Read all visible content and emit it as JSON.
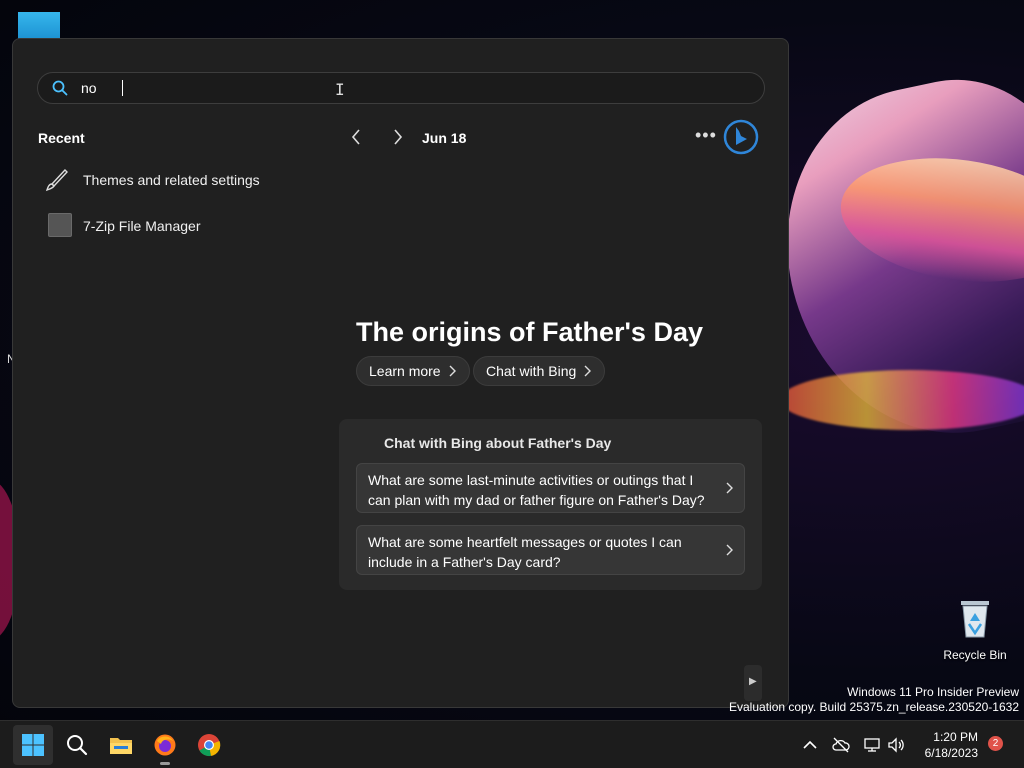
{
  "search": {
    "query": "no"
  },
  "recent": {
    "title": "Recent",
    "items": [
      {
        "label": "Themes and related settings",
        "icon": "brush-icon"
      },
      {
        "label": "7-Zip File Manager",
        "icon": "app-icon"
      }
    ]
  },
  "date": "Jun 18",
  "highlight": {
    "title": "The origins of Father's Day",
    "learn_more": "Learn more",
    "chat_with_bing": "Chat with Bing"
  },
  "chat": {
    "title": "Chat with Bing about Father's Day",
    "suggestions": [
      "What are some last-minute activities or outings that I can plan with my dad or father figure on Father's Day?",
      "What are some heartfelt messages or quotes I can include in a Father's Day card?"
    ]
  },
  "desktop": {
    "recycle_bin": "Recycle Bin",
    "watermark_line1": "Windows 11 Pro Insider Preview",
    "watermark_line2": "Evaluation copy. Build 25375.zn_release.230520-1632",
    "edge_letter": "N"
  },
  "taskbar": {
    "time": "1:20 PM",
    "date": "6/18/2023",
    "notification_count": "2"
  },
  "colors": {
    "accent": "#4cc2ff",
    "panel": "#202020"
  }
}
